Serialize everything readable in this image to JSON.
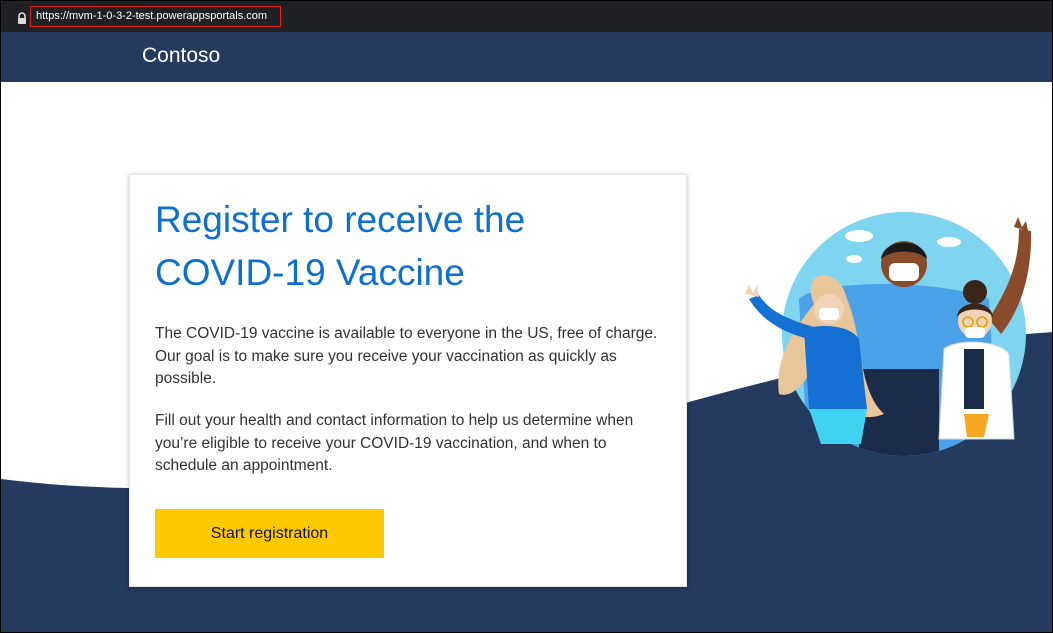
{
  "browser": {
    "url": "https://mvm-1-0-3-2-test.powerappsportals.com"
  },
  "header": {
    "brand": "Contoso"
  },
  "card": {
    "title": "Register to receive the COVID-19 Vaccine",
    "paragraph1": "The COVID-19 vaccine is available to everyone in the US, free of charge. Our goal is to make sure you receive your vaccination as quickly as possible.",
    "paragraph2": "Fill out your health and contact information to help us determine when you’re eligible to receive your COVID-19 vaccination, and when to schedule an appointment.",
    "button_label": "Start registration"
  },
  "colors": {
    "nav": "#243a5e",
    "wave": "#243a5e",
    "heading": "#0d6fcf",
    "button": "#ffc900",
    "url_highlight": "#e0201e"
  },
  "icons": [
    "lock-icon",
    "vaccine-people-illustration"
  ]
}
